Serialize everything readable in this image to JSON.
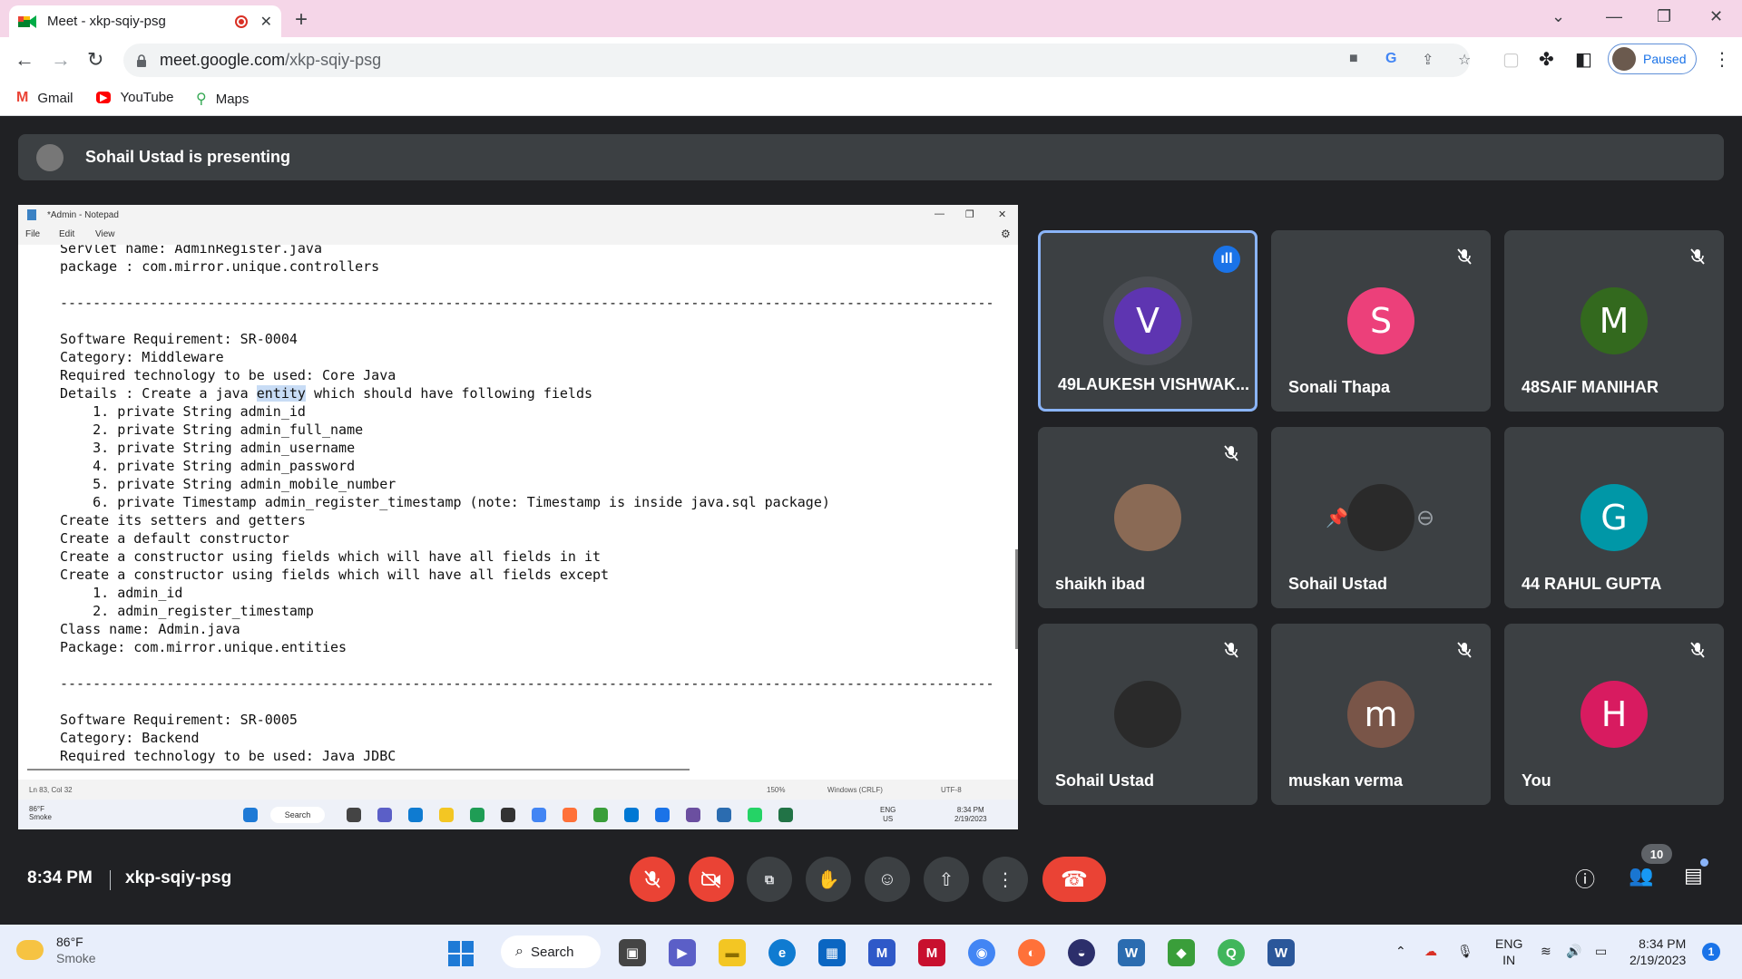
{
  "browser": {
    "tab_title": "Meet - xkp-sqiy-psg",
    "new_tab": "+",
    "tab_close": "✕",
    "url_host": "meet.google.com",
    "url_path": "/xkp-sqiy-psg",
    "profile_status": "Paused",
    "bookmarks": [
      {
        "label": "Gmail",
        "icon": "gmail-icon",
        "glyph": "M",
        "color": "#ea4335"
      },
      {
        "label": "YouTube",
        "icon": "youtube-icon",
        "glyph": "▶",
        "color": "#ff0000"
      },
      {
        "label": "Maps",
        "icon": "maps-icon",
        "glyph": "⚲",
        "color": "#34a853"
      }
    ]
  },
  "meet": {
    "presenting_banner": "Sohail Ustad is presenting",
    "time": "8:34 PM",
    "code": "xkp-sqiy-psg",
    "participant_count": "10",
    "participants": [
      {
        "name": "49LAUKESH VISHWAK...",
        "initial": "V",
        "color": "#5e35b1",
        "status": "speaking"
      },
      {
        "name": "Sonali Thapa",
        "initial": "S",
        "color": "#ec407a",
        "status": "muted"
      },
      {
        "name": "48SAIF MANIHAR",
        "initial": "M",
        "color": "#33691e",
        "status": "muted"
      },
      {
        "name": "shaikh ibad",
        "initial": "",
        "color": "#8a6a55",
        "status": "muted"
      },
      {
        "name": "Sohail Ustad",
        "initial": "",
        "color": "#2a2a2a",
        "status": "presenting"
      },
      {
        "name": "44 RAHUL GUPTA",
        "initial": "G",
        "color": "#0097a7",
        "status": "none"
      },
      {
        "name": "Sohail Ustad",
        "initial": "",
        "color": "#2a2a2a",
        "status": "muted"
      },
      {
        "name": "muskan verma",
        "initial": "m",
        "color": "#795548",
        "status": "muted"
      },
      {
        "name": "You",
        "initial": "H",
        "color": "#d81b60",
        "status": "muted"
      }
    ]
  },
  "notepad": {
    "title": "*Admin - Notepad",
    "menu": [
      "File",
      "Edit",
      "View"
    ],
    "lines": [
      "Servlet name: AdminRegister.java",
      "package : com.mirror.unique.controllers",
      "",
      "------------------------------------------------------------------------------------------------------------------",
      "",
      "Software Requirement: SR-0004",
      "Category: Middleware",
      "Required technology to be used: Core Java",
      "Details : Create a java entity which should have following fields",
      "    1. private String admin_id",
      "    2. private String admin_full_name",
      "    3. private String admin_username",
      "    4. private String admin_password",
      "    5. private String admin_mobile_number",
      "    6. private Timestamp admin_register_timestamp (note: Timestamp is inside java.sql package)",
      "Create its setters and getters",
      "Create a default constructor",
      "Create a constructor using fields which will have all fields in it",
      "Create a constructor using fields which will have all fields except",
      "    1. admin_id",
      "    2. admin_register_timestamp",
      "Class name: Admin.java",
      "Package: com.mirror.unique.entities",
      "",
      "------------------------------------------------------------------------------------------------------------------",
      "",
      "Software Requirement: SR-0005",
      "Category: Backend",
      "Required technology to be used: Java JDBC"
    ],
    "highlight_prefix": "Details : Create a java ",
    "highlight_word": "entity",
    "highlight_suffix": " which should have following fields",
    "status": {
      "position": "Ln 83, Col 32",
      "zoom": "150%",
      "eol": "Windows (CRLF)",
      "encoding": "UTF-8"
    },
    "inner_taskbar": {
      "temp": "86°F",
      "cond": "Smoke",
      "search": "Search",
      "lang1": "ENG",
      "lang2": "US",
      "time": "8:34 PM",
      "date": "2/19/2023"
    }
  },
  "taskbar": {
    "temp": "86°F",
    "condition": "Smoke",
    "search": "Search",
    "lang1": "ENG",
    "lang2": "IN",
    "time": "8:34 PM",
    "date": "2/19/2023",
    "notifications": "1"
  }
}
